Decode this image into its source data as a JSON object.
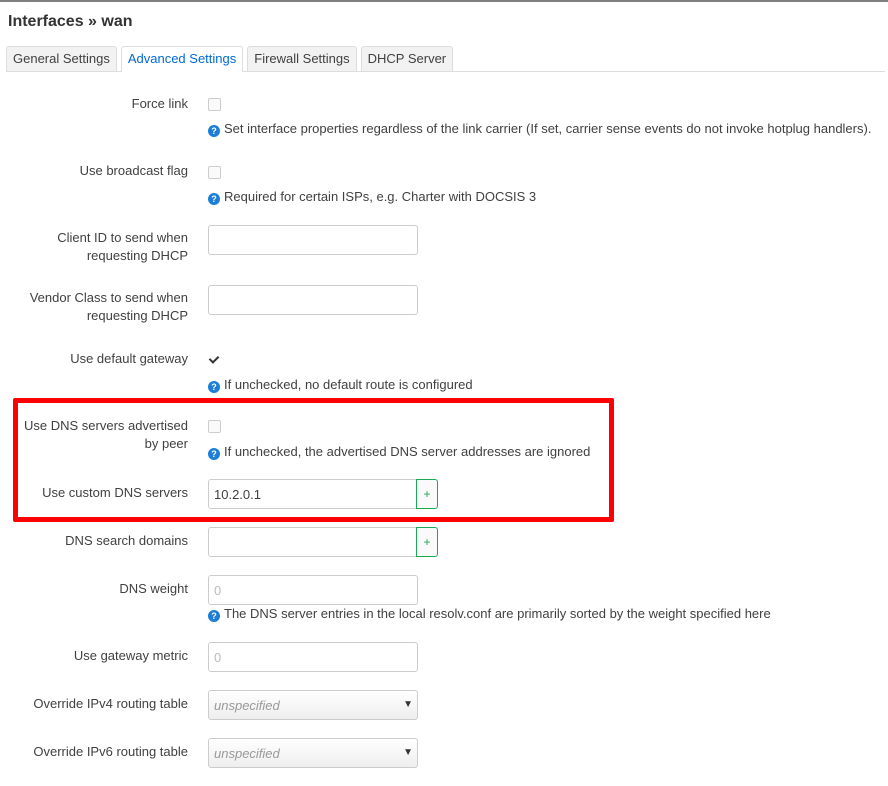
{
  "page": {
    "title": "Interfaces » wan"
  },
  "tabs": [
    {
      "label": "General Settings",
      "active": false
    },
    {
      "label": "Advanced Settings",
      "active": true
    },
    {
      "label": "Firewall Settings",
      "active": false
    },
    {
      "label": "DHCP Server",
      "active": false
    }
  ],
  "fields": {
    "force_link": {
      "label": "Force link",
      "checked": false,
      "help": "Set interface properties regardless of the link carrier (If set, carrier sense events do not invoke hotplug handlers)."
    },
    "broadcast_flag": {
      "label": "Use broadcast flag",
      "checked": false,
      "help": "Required for certain ISPs, e.g. Charter with DOCSIS 3"
    },
    "client_id": {
      "label_line1": "Client ID to send when",
      "label_line2": "requesting DHCP",
      "value": ""
    },
    "vendor_class": {
      "label_line1": "Vendor Class to send when",
      "label_line2": "requesting DHCP",
      "value": ""
    },
    "default_gateway": {
      "label": "Use default gateway",
      "checked": true,
      "help": "If unchecked, no default route is configured"
    },
    "peer_dns": {
      "label_line1": "Use DNS servers advertised",
      "label_line2": "by peer",
      "checked": false,
      "help": "If unchecked, the advertised DNS server addresses are ignored"
    },
    "custom_dns": {
      "label": "Use custom DNS servers",
      "value": "10.2.0.1",
      "add_label": "+"
    },
    "dns_search": {
      "label": "DNS search domains",
      "value": "",
      "add_label": "+"
    },
    "dns_weight": {
      "label": "DNS weight",
      "placeholder": "0",
      "help": "The DNS server entries in the local resolv.conf are primarily sorted by the weight specified here"
    },
    "gateway_metric": {
      "label": "Use gateway metric",
      "placeholder": "0"
    },
    "ipv4_table": {
      "label": "Override IPv4 routing table",
      "value": "unspecified"
    },
    "ipv6_table": {
      "label": "Override IPv6 routing table",
      "value": "unspecified"
    }
  },
  "icons": {
    "help": "?",
    "dropdown": "▼"
  },
  "annotation": {
    "color": "#ff0000"
  }
}
